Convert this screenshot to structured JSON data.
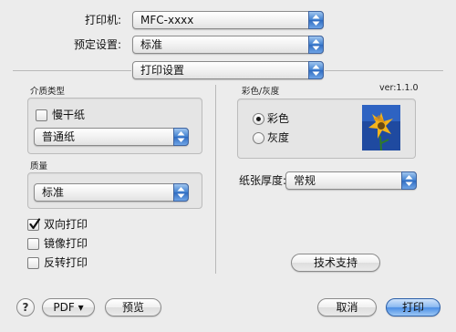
{
  "printer": {
    "label": "打印机:",
    "value": "MFC-xxxx"
  },
  "presets": {
    "label": "预定设置:",
    "value": "标准"
  },
  "panel": {
    "value": "打印设置"
  },
  "version": "ver:1.1.0",
  "media_type": {
    "title": "介质类型",
    "slow_dry_label": "慢干纸",
    "slow_dry_checked": false,
    "value": "普通纸"
  },
  "quality": {
    "title": "质量",
    "value": "标准"
  },
  "options": {
    "bidirectional": {
      "label": "双向打印",
      "checked": true
    },
    "mirror": {
      "label": "镜像打印",
      "checked": false
    },
    "reverse": {
      "label": "反转打印",
      "checked": false
    }
  },
  "color": {
    "title": "彩色/灰度",
    "color_label": "彩色",
    "gray_label": "灰度",
    "selected": "color"
  },
  "thickness": {
    "label": "纸张厚度:",
    "value": "常规"
  },
  "support_button": "技术支持",
  "footer": {
    "help": "?",
    "pdf": "PDF ▾",
    "preview": "预览",
    "cancel": "取消",
    "print": "打印"
  }
}
